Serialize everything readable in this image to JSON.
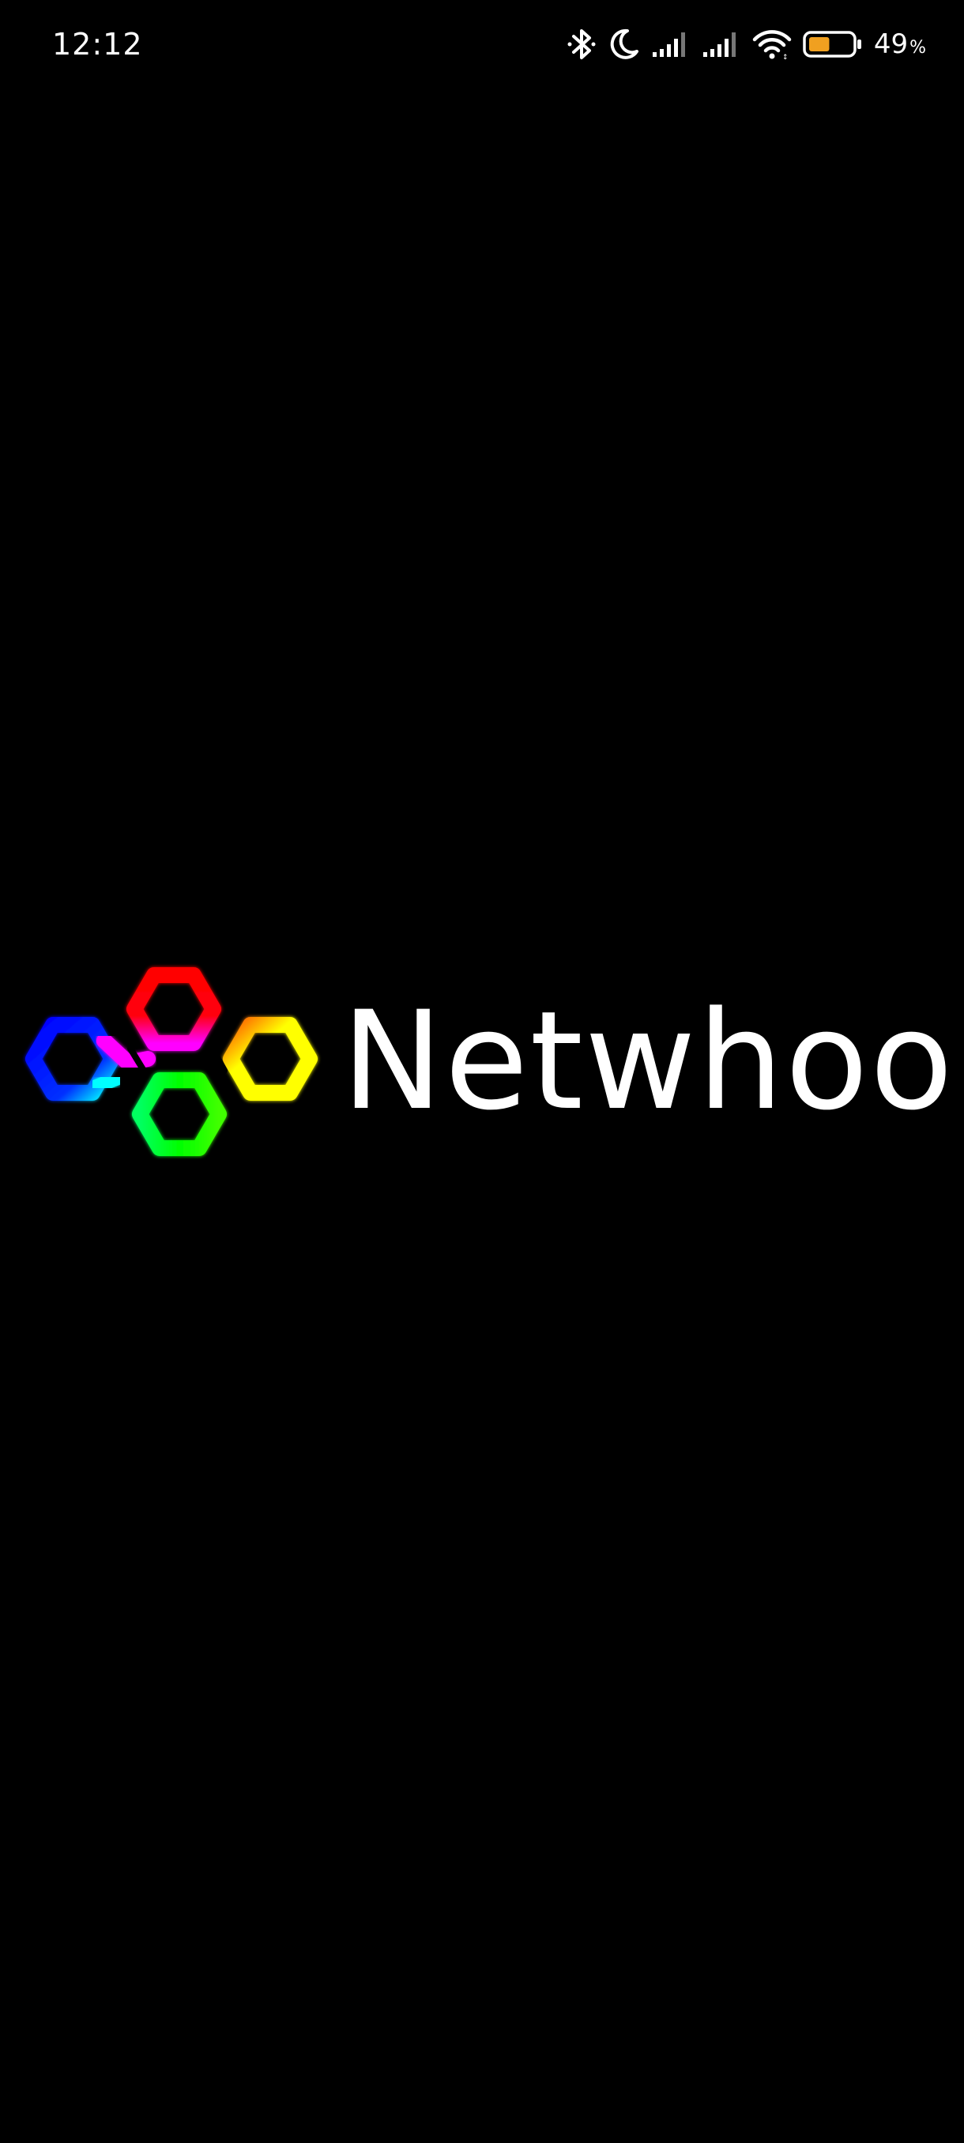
{
  "status_bar": {
    "time": "12:12",
    "battery_percent": "49",
    "battery_unit": "%",
    "battery_level": 0.49,
    "battery_color": "#f0a020",
    "icons": [
      "bluetooth-icon",
      "moon-icon",
      "signal-1-icon",
      "signal-2-icon",
      "wifi-icon",
      "battery-icon"
    ]
  },
  "splash": {
    "brand_name": "Netwhoo",
    "logo": {
      "hexagon_colors": [
        "#0000ff",
        "#ff0000",
        "#ffff00",
        "#00ff00",
        "#ff00ff",
        "#00ffff"
      ]
    }
  },
  "background_color": "#000000"
}
